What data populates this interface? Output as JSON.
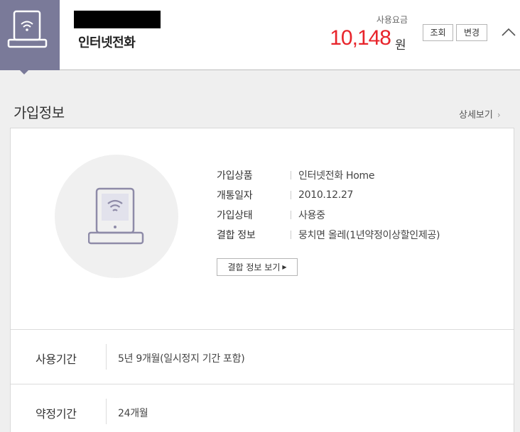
{
  "header": {
    "service_icon": "tablet-wifi-icon",
    "service_name": "인터넷전화",
    "fee_label": "사용요금",
    "fee_amount": "10,148",
    "fee_unit": "원",
    "inquiry_label": "조회",
    "change_label": "변경",
    "collapse_icon": "chevron-up-icon"
  },
  "section": {
    "title": "가입정보",
    "detail_link": "상세보기",
    "detail_chevron": "›"
  },
  "info": {
    "rows": [
      {
        "label": "가입상품",
        "value": "인터넷전화 Home"
      },
      {
        "label": "개통일자",
        "value": "2010.12.27"
      },
      {
        "label": "가입상태",
        "value": "사용중"
      },
      {
        "label": "결합 정보",
        "value": "뭉치면 올레(1년약정이상할인제공)"
      }
    ],
    "combo_button_label": "결합 정보 보기",
    "combo_button_arrow": "▶"
  },
  "periods": [
    {
      "label": "사용기간",
      "value": "5년 9개월(일시정지 기간 포함)"
    },
    {
      "label": "약정기간",
      "value": "24개월"
    }
  ],
  "colors": {
    "accent_purple": "#7a7a99",
    "fee_red": "#e8242b"
  }
}
